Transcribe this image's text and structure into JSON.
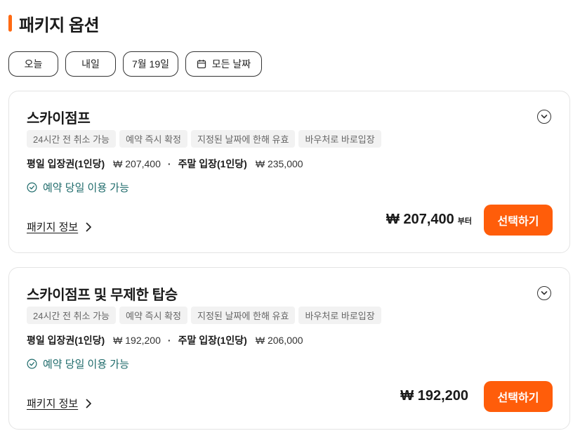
{
  "section": {
    "title": "패키지 옵션",
    "accent_color": "#ff6a13"
  },
  "date_filters": [
    {
      "label": "오늘"
    },
    {
      "label": "내일"
    },
    {
      "label": "7월 19일"
    },
    {
      "label": "모든 날짜",
      "icon": "calendar-icon"
    }
  ],
  "packages": [
    {
      "title": "스카이점프",
      "tags": [
        "24시간 전 취소 가능",
        "예약 즉시 확정",
        "지정된 날짜에 한해 유효",
        "바우처로 바로입장"
      ],
      "weekday_label": "평일 입장권(1인당)",
      "weekday_price": "₩ 207,400",
      "weekend_label": "주말 입장(1인당)",
      "weekend_price": "₩ 235,000",
      "availability": "예약 당일 이용 가능",
      "info_link": "패키지 정보",
      "total_price": "₩ 207,400",
      "total_suffix": "부터",
      "select_label": "선택하기"
    },
    {
      "title": "스카이점프 및 무제한 탑승",
      "tags": [
        "24시간 전 취소 가능",
        "예약 즉시 확정",
        "지정된 날짜에 한해 유효",
        "바우처로 바로입장"
      ],
      "weekday_label": "평일 입장권(1인당)",
      "weekday_price": "₩ 192,200",
      "weekend_label": "주말 입장(1인당)",
      "weekend_price": "₩ 206,000",
      "availability": "예약 당일 이용 가능",
      "info_link": "패키지 정보",
      "total_price": "₩ 192,200",
      "total_suffix": "",
      "select_label": "선택하기"
    }
  ],
  "colors": {
    "primary_button": "#ff5d0a",
    "availability_text": "#1f6b6b"
  }
}
